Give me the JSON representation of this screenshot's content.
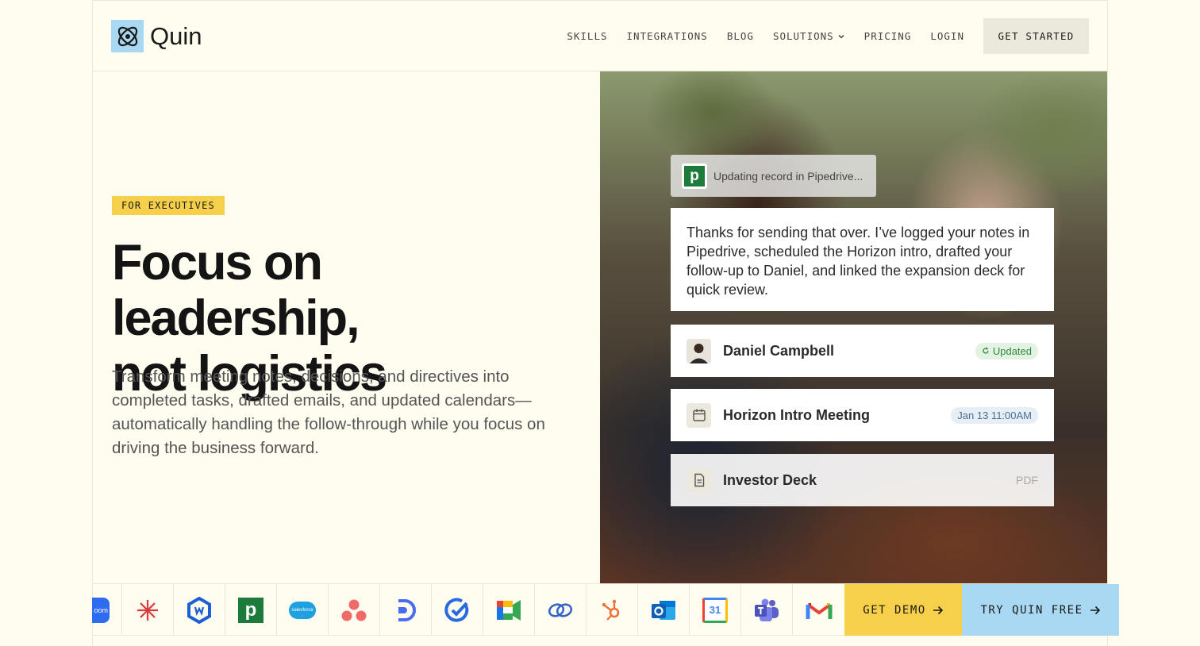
{
  "brand": {
    "name": "Quin"
  },
  "nav": {
    "items": [
      "SKILLS",
      "INTEGRATIONS",
      "BLOG",
      "SOLUTIONS",
      "PRICING",
      "LOGIN"
    ],
    "cta": "GET STARTED"
  },
  "hero": {
    "badge": "FOR EXECUTIVES",
    "headline_line1": "Focus on leadership,",
    "headline_line2": "not logistics",
    "subtitle": "Transform meeting notes, decisions, and directives into completed tasks, drafted emails, and updated calendars—automatically handling the follow-through while you focus on driving the business forward."
  },
  "demo": {
    "status": "Updating record in Pipedrive...",
    "message": "Thanks for sending that over. I’ve logged your notes in Pipedrive, scheduled the Horizon intro, drafted your follow-up to Daniel, and linked the expansion deck for quick review.",
    "cards": [
      {
        "title": "Daniel Campbell",
        "tag": "Updated"
      },
      {
        "title": "Horizon Intro Meeting",
        "tag": "Jan 13 11:00AM"
      },
      {
        "title": "Investor Deck",
        "tag": "PDF"
      }
    ]
  },
  "integrations": [
    "zoom",
    "asterisk",
    "wrike",
    "pipedrive",
    "salesforce",
    "asana",
    "dialpad",
    "check",
    "google-meet",
    "link",
    "hubspot",
    "outlook",
    "google-calendar",
    "teams",
    "gmail"
  ],
  "salesforce_text": "salesforce",
  "calendar_day": "31",
  "zoom_text": "oom",
  "cta": {
    "demo": "GET DEMO",
    "try": "TRY QUIN FREE"
  },
  "colors": {
    "yellow": "#f7d04b",
    "blue": "#a9d8f2",
    "background": "#fffdf0"
  }
}
